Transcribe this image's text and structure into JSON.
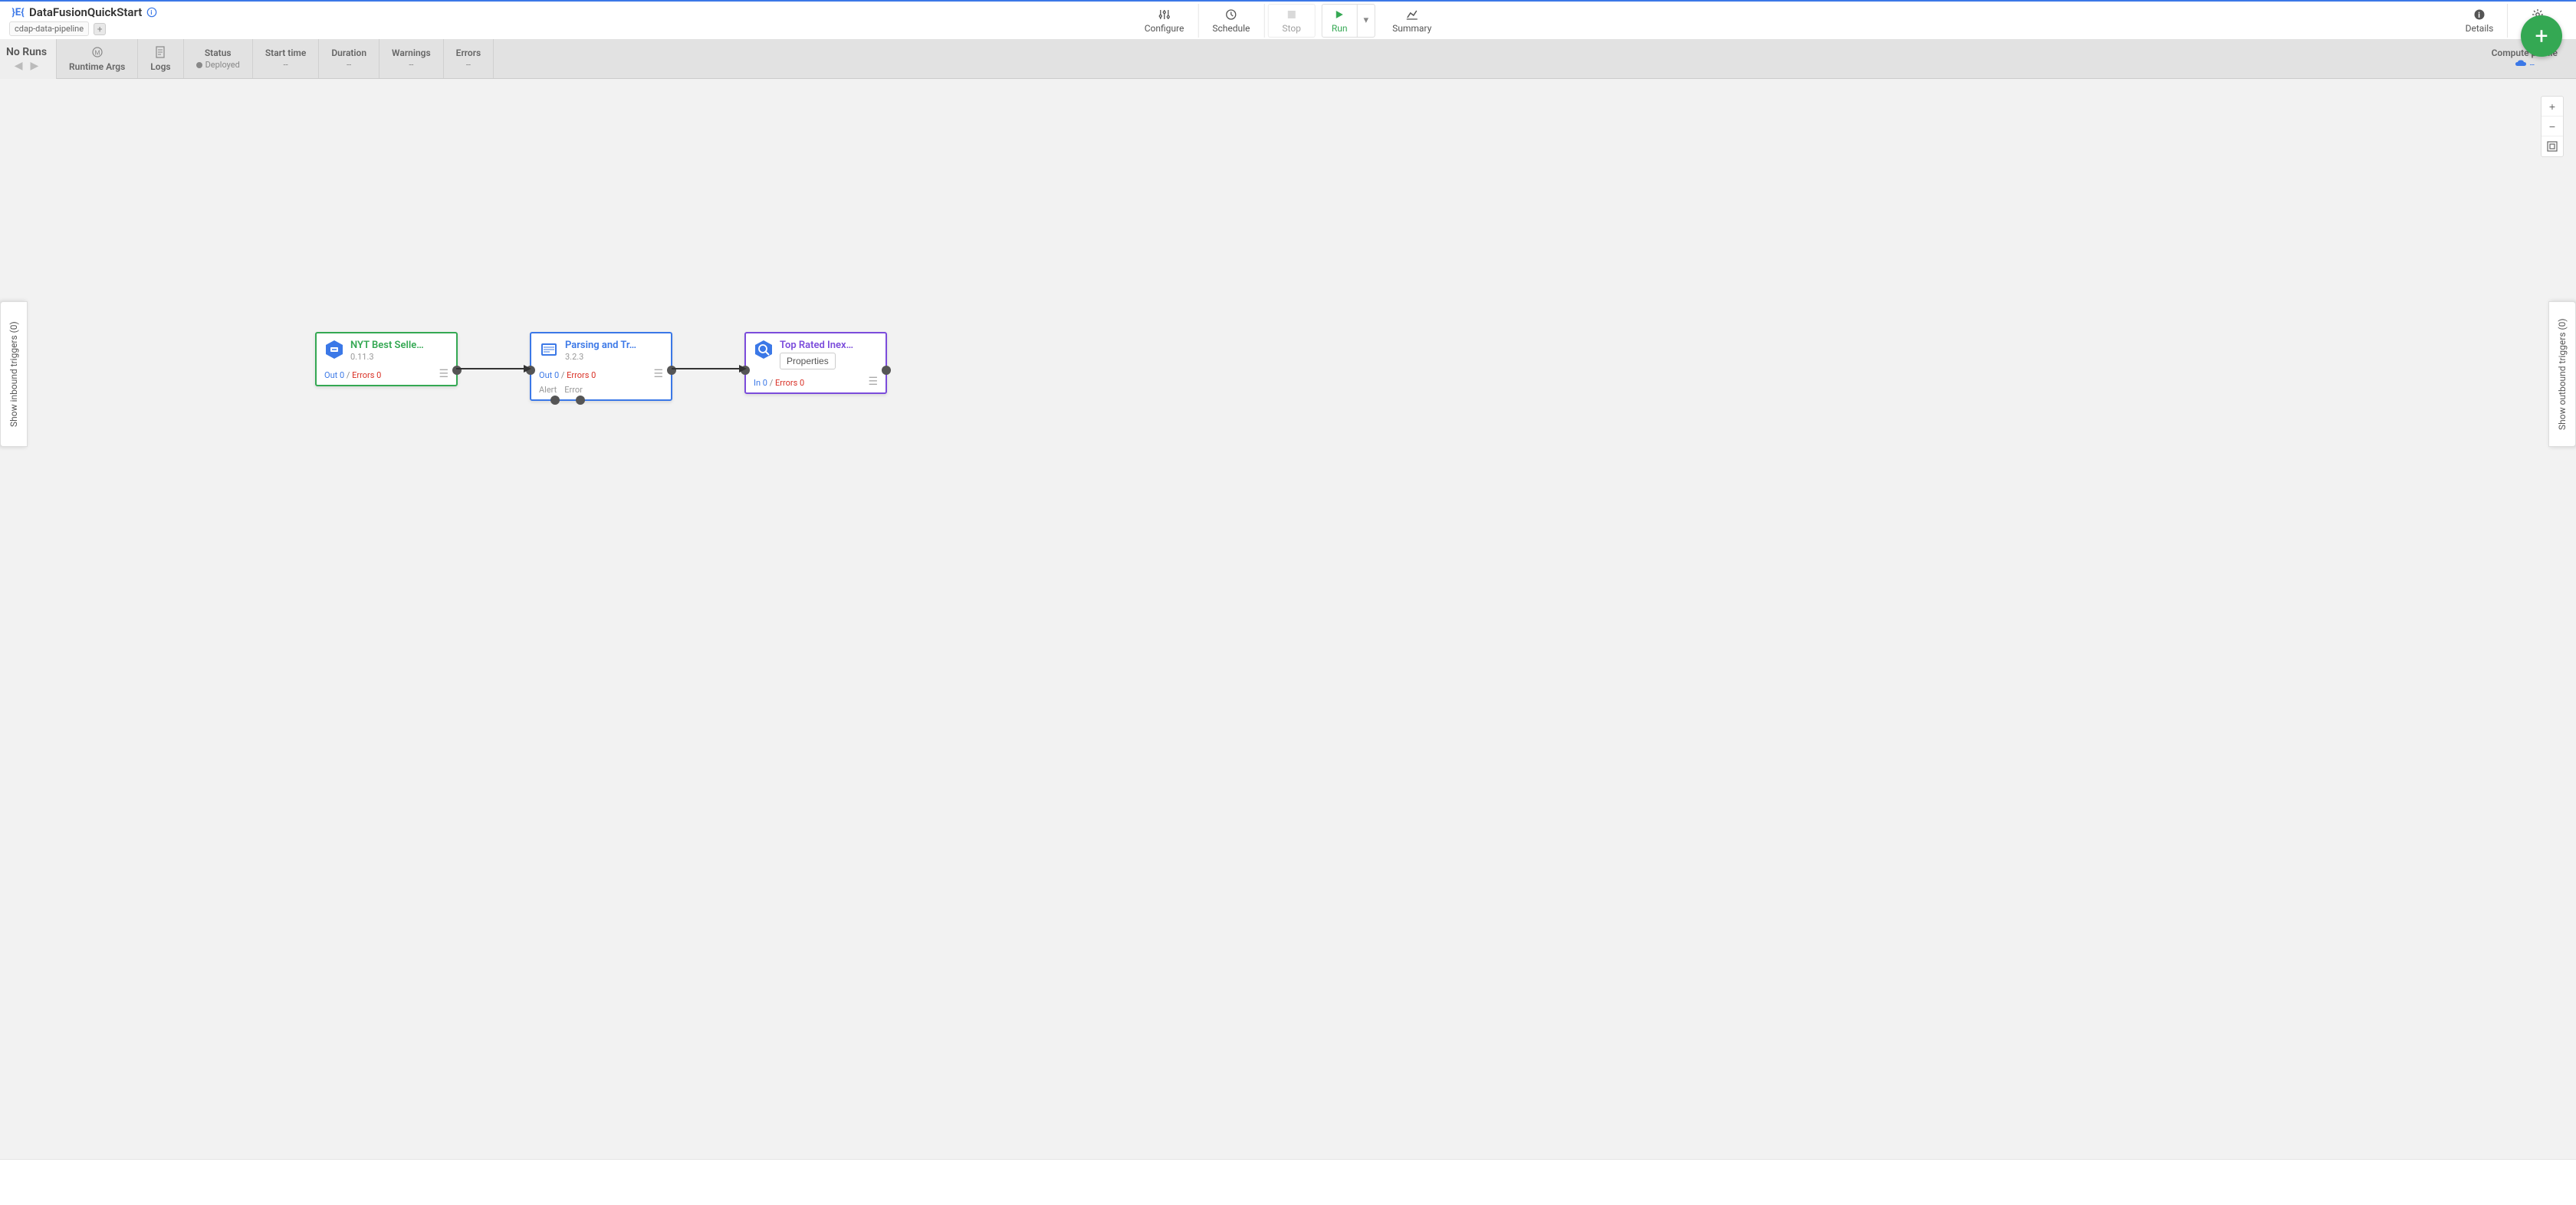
{
  "header": {
    "title": "DataFusionQuickStart",
    "tag": "cdap-data-pipeline",
    "buttons": {
      "configure": "Configure",
      "schedule": "Schedule",
      "stop": "Stop",
      "run": "Run",
      "summary": "Summary",
      "details": "Details",
      "actions": "Actions"
    }
  },
  "statusbar": {
    "noruns": "No Runs",
    "runtime_args": "Runtime Args",
    "logs": "Logs",
    "status_label": "Status",
    "status_value": "Deployed",
    "start_time_label": "Start time",
    "start_time_value": "--",
    "duration_label": "Duration",
    "duration_value": "--",
    "warnings_label": "Warnings",
    "warnings_value": "--",
    "errors_label": "Errors",
    "errors_value": "--",
    "compute_label": "Compute profile",
    "compute_value": "--"
  },
  "triggers": {
    "inbound": "Show inbound triggers (0)",
    "outbound": "Show outbound triggers (0)"
  },
  "nodes": [
    {
      "title": "NYT Best Selle…",
      "version": "0.11.3",
      "metric_left": "Out 0",
      "metric_right": "Errors 0"
    },
    {
      "title": "Parsing and Tr…",
      "version": "3.2.3",
      "metric_left": "Out 0",
      "metric_right": "Errors 0",
      "alert": "Alert",
      "error": "Error"
    },
    {
      "title": "Top Rated Inex…",
      "properties": "Properties",
      "metric_left": "In 0",
      "metric_right": "Errors 0"
    }
  ]
}
